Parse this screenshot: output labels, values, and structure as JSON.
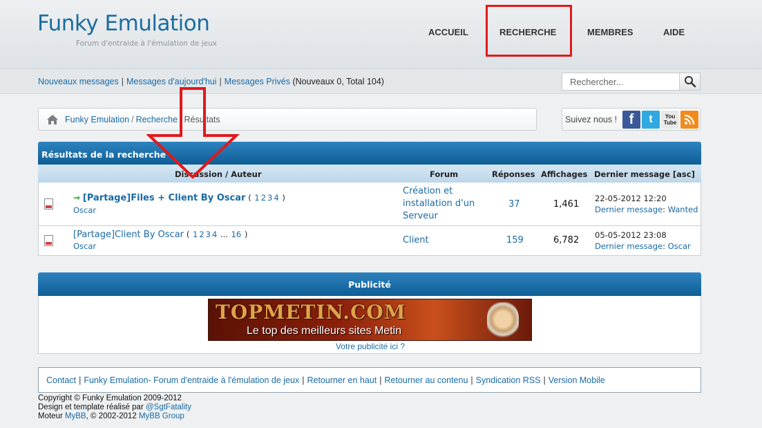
{
  "header": {
    "logo_title": "Funky Emulation",
    "logo_subtitle": "Forum d'entraide à l'émulation de jeux",
    "nav": [
      {
        "label": "ACCUEIL"
      },
      {
        "label": "RECHERCHE"
      },
      {
        "label": "MEMBRES"
      },
      {
        "label": "AIDE"
      }
    ]
  },
  "subbar": {
    "links": [
      "Nouveaux messages",
      "Messages d'aujourd'hui",
      "Messages Privés"
    ],
    "pm_status": "(Nouveaux 0, Total 104)",
    "search_placeholder": "Rechercher..."
  },
  "breadcrumb": {
    "items": [
      "Funky Emulation",
      "Recherche"
    ],
    "current": "Résultats"
  },
  "social": {
    "label": "Suivez nous !",
    "icons": [
      "facebook-icon",
      "twitter-icon",
      "youtube-icon",
      "rss-icon"
    ],
    "youtube_text": "You Tube"
  },
  "results": {
    "title": "Résultats de la recherche",
    "columns": {
      "discussion": "Discussion / Auteur",
      "forum": "Forum",
      "replies": "Réponses",
      "views": "Affichages",
      "last": "Dernier message [asc]"
    },
    "rows": [
      {
        "title": "[Partage]Files + Client By Oscar",
        "pages_open": "(",
        "pages": [
          "1",
          "2",
          "3",
          "4"
        ],
        "pages_close": ")",
        "author": "Oscar",
        "forum": "Création et installation d'un Serveur",
        "replies": "37",
        "views": "1,461",
        "last_date": "22-05-2012 12:20",
        "last_label": "Dernier message",
        "last_user": "Wanted"
      },
      {
        "title": "[Partage]Client By Oscar",
        "pages_open": "(",
        "pages": [
          "1",
          "2",
          "3",
          "4"
        ],
        "pages_ellipsis": "...",
        "last_page": "16",
        "pages_close": ")",
        "author": "Oscar",
        "forum": "Client",
        "replies": "159",
        "views": "6,782",
        "last_date": "05-05-2012 23:08",
        "last_label": "Dernier message",
        "last_user": "Oscar"
      }
    ]
  },
  "ad": {
    "title": "Publicité",
    "banner_title": "TOPMETIN.COM",
    "banner_sub": "Le top des meilleurs sites Metin",
    "link": "Votre publicité ici ?"
  },
  "footer": {
    "links": [
      "Contact",
      "Funky Emulation- Forum d'entraide à l'émulation de jeux",
      "Retourner en haut",
      "Retourner au contenu",
      "Syndication RSS",
      "Version Mobile"
    ],
    "copyright": "Copyright © Funky Emulation 2009-2012",
    "design_prefix": "Design et template réalisé par",
    "design_author": "@SgtFatality",
    "engine_prefix": "Moteur",
    "engine_name": "MyBB",
    "engine_mid": ", © 2002-2012",
    "engine_group": "MyBB Group"
  },
  "colors": {
    "brand": "#1b6d9d",
    "link": "#1a6aa5",
    "header_bar": "#0f5e95",
    "annotation": "#e3181b"
  }
}
